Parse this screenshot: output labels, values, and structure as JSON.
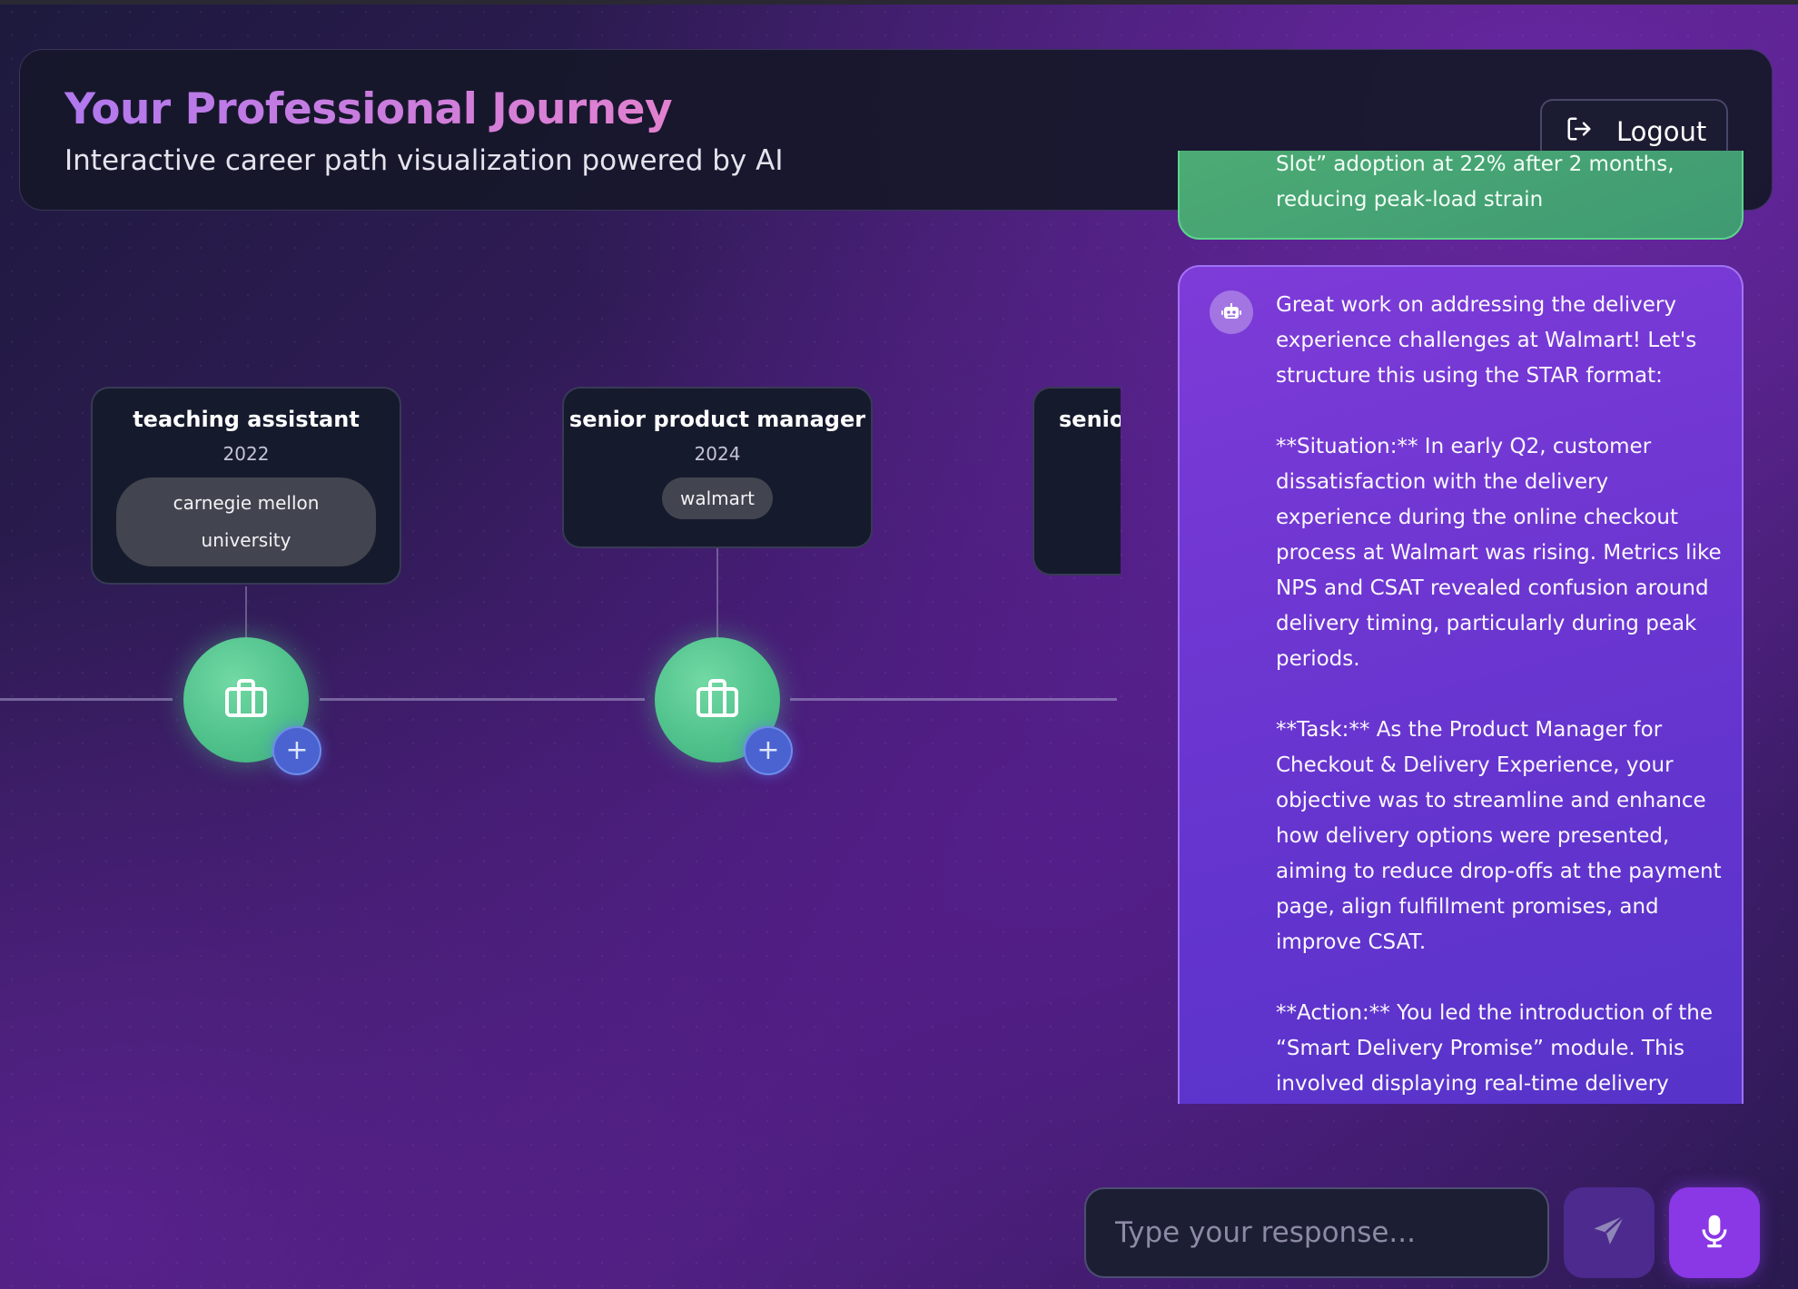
{
  "header": {
    "title": "Your Professional Journey",
    "subtitle": "Interactive career path visualization powered by AI",
    "logout_label": "Logout",
    "logout_icon": "logout-icon"
  },
  "timeline": {
    "entries": [
      {
        "title": "teaching assistant",
        "year": "2022",
        "company": "carnegie mellon university",
        "icon": "briefcase-icon",
        "action": "+"
      },
      {
        "title": "senior product manager",
        "year": "2024",
        "company": "walmart",
        "icon": "briefcase-icon",
        "action": "+"
      },
      {
        "title": "senio",
        "year": "",
        "company": "",
        "icon": "briefcase-icon",
        "action": "+"
      }
    ]
  },
  "chat": {
    "user_message": "Slot” adoption at 22% after 2 months, reducing peak-load strain",
    "ai_icon": "robot-icon",
    "ai_message": "Great work on addressing the delivery experience challenges at Walmart! Let's structure this using the STAR format:\n\n**Situation:** In early Q2, customer dissatisfaction with the delivery experience during the online checkout process at Walmart was rising. Metrics like NPS and CSAT revealed confusion around delivery timing, particularly during peak periods.\n\n**Task:** As the Product Manager for Checkout & Delivery Experience, your objective was to streamline and enhance how delivery options were presented, aiming to reduce drop-offs at the payment page, align fulfillment promises, and improve CSAT.\n\n**Action:** You led the introduction of the “Smart Delivery Promise” module. This involved displaying real-time delivery"
  },
  "composer": {
    "placeholder": "Type your response...",
    "send_icon": "send-icon",
    "mic_icon": "microphone-icon"
  },
  "colors": {
    "node_green": "#4ec08a",
    "plus_blue": "#4a63d1",
    "ai_bubble": "#7e3bd8",
    "user_bubble": "#4fae74",
    "mic_purple": "#8a37e6"
  }
}
